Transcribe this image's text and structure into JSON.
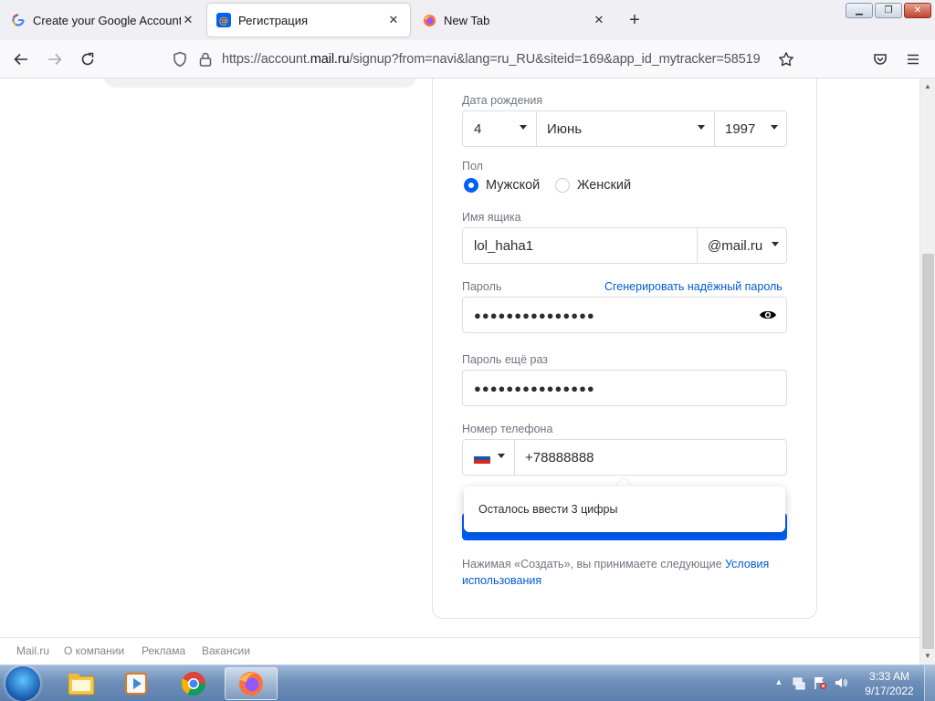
{
  "browser": {
    "tabs": [
      {
        "title": "Create your Google Account",
        "icon": "google-icon",
        "active": false
      },
      {
        "title": "Регистрация",
        "icon": "mailru-icon",
        "active": true
      },
      {
        "title": "New Tab",
        "icon": "firefox-icon",
        "active": false
      }
    ],
    "url_prefix": "https://account.",
    "url_domain": "mail.ru",
    "url_suffix": "/signup?from=navi&lang=ru_RU&siteid=169&app_id_mytracker=58519"
  },
  "form": {
    "birth_label": "Дата рождения",
    "birth_day": "4",
    "birth_month": "Июнь",
    "birth_year": "1997",
    "gender_label": "Пол",
    "gender_male": "Мужской",
    "gender_female": "Женский",
    "gender_selected": "male",
    "mailbox_label": "Имя ящика",
    "mailbox_value": "lol_haha1",
    "mailbox_domain": "@mail.ru",
    "password_label": "Пароль",
    "generate_link": "Сгенерировать надёжный пароль",
    "password_masked": "●●●●●●●●●●●●●●●",
    "password_repeat_label": "Пароль ещё раз",
    "password_repeat_masked": "●●●●●●●●●●●●●●●",
    "phone_label": "Номер телефона",
    "phone_value": "+78888888",
    "tooltip": "Осталось ввести 3 цифры",
    "terms_text": "Нажимая «Создать», вы принимаете следующие ",
    "terms_link": "Условия использования"
  },
  "footer": {
    "links": [
      "Mail.ru",
      "О компании",
      "Реклама",
      "Вакансии"
    ]
  },
  "taskbar": {
    "apps": [
      "explorer-icon",
      "media-player-icon",
      "chrome-icon",
      "firefox-icon"
    ],
    "time": "3:33 AM",
    "date": "9/17/2022"
  },
  "colors": {
    "accent": "#005ff9",
    "link": "#005bd1"
  }
}
